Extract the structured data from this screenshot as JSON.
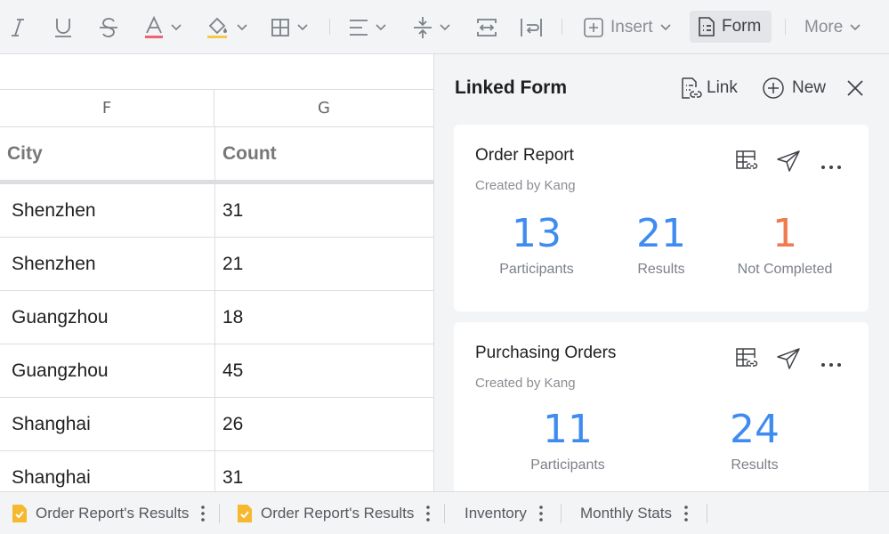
{
  "toolbar": {
    "items": [
      {
        "icon": "italic-icon"
      },
      {
        "icon": "underline-icon"
      },
      {
        "icon": "strikethrough-icon"
      },
      {
        "icon": "font-color-icon",
        "accent": "#f06273"
      },
      {
        "icon": "fill-color-icon",
        "accent": "#f7c948"
      },
      {
        "icon": "borders-icon"
      },
      {
        "icon": "align-icon"
      },
      {
        "icon": "vertical-align-icon"
      },
      {
        "icon": "merge-cells-icon"
      },
      {
        "icon": "wrap-text-icon"
      }
    ],
    "insert_label": "Insert",
    "form_label": "Form",
    "more_label": "More"
  },
  "sheet": {
    "columns": [
      "F",
      "G"
    ],
    "header": {
      "city": "City",
      "count": "Count"
    },
    "rows": [
      {
        "city": "Shenzhen",
        "count": "31"
      },
      {
        "city": "Shenzhen",
        "count": "21"
      },
      {
        "city": "Guangzhou",
        "count": "18"
      },
      {
        "city": "Guangzhou",
        "count": "45"
      },
      {
        "city": "Shanghai",
        "count": "26"
      },
      {
        "city": "Shanghai",
        "count": "31"
      }
    ]
  },
  "panel": {
    "title": "Linked Form",
    "link_label": "Link",
    "new_label": "New",
    "forms": [
      {
        "title": "Order Report",
        "creator": "Created by Kang",
        "stats": [
          {
            "value": "13",
            "label": "Participants",
            "color": "#3f8cf0"
          },
          {
            "value": "21",
            "label": "Results",
            "color": "#3f8cf0"
          },
          {
            "value": "1",
            "label": "Not Completed",
            "color": "#ef7b4f"
          }
        ]
      },
      {
        "title": "Purchasing Orders",
        "creator": "Created by Kang",
        "stats": [
          {
            "value": "11",
            "label": "Participants",
            "color": "#3f8cf0"
          },
          {
            "value": "24",
            "label": "Results",
            "color": "#3f8cf0"
          }
        ]
      }
    ]
  },
  "tabs": [
    {
      "label": "Order Report's Results",
      "form": true
    },
    {
      "label": "Order Report's Results",
      "form": true
    },
    {
      "label": "Inventory",
      "form": false
    },
    {
      "label": "Monthly Stats",
      "form": false
    }
  ]
}
